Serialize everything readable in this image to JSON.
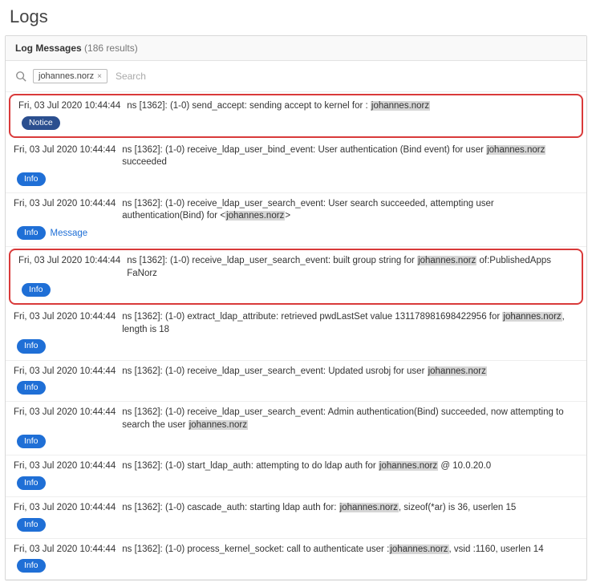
{
  "page": {
    "title": "Logs"
  },
  "panel": {
    "header_title": "Log Messages",
    "results_label": "(186 results)"
  },
  "filter": {
    "chip": "johannes.norz",
    "chip_close": "×",
    "placeholder": "Search"
  },
  "badges": {
    "info": "Info",
    "notice": "Notice"
  },
  "user_highlight": "johannes.norz",
  "entries": [
    {
      "ts": "Fri, 03 Jul 2020 10:44:44",
      "pre": "ns [1362]: (1-0) send_accept: sending accept to kernel for : ",
      "post": "",
      "level": "notice",
      "boxed": true
    },
    {
      "ts": "Fri, 03 Jul 2020 10:44:44",
      "pre": "ns [1362]: (1-0) receive_ldap_user_bind_event: User authentication (Bind event) for user ",
      "post": " succeeded",
      "level": "info"
    },
    {
      "ts": "Fri, 03 Jul 2020 10:44:44",
      "pre": "ns [1362]: (1-0) receive_ldap_user_search_event: User search succeeded, attempting user authentication(Bind) for <",
      "post": ">",
      "level": "info",
      "extra": "Message"
    },
    {
      "ts": "Fri, 03 Jul 2020 10:44:44",
      "pre": "ns [1362]: (1-0) receive_ldap_user_search_event: built group string for ",
      "post": " of:PublishedApps FaNorz",
      "level": "info",
      "boxed": true
    },
    {
      "ts": "Fri, 03 Jul 2020 10:44:44",
      "pre": "ns [1362]: (1-0) extract_ldap_attribute: retrieved pwdLastSet value 131178981698422956 for ",
      "post": ", length is 18",
      "level": "info"
    },
    {
      "ts": "Fri, 03 Jul 2020 10:44:44",
      "pre": "ns [1362]: (1-0) receive_ldap_user_search_event: Updated usrobj for user ",
      "post": "",
      "level": "info"
    },
    {
      "ts": "Fri, 03 Jul 2020 10:44:44",
      "pre": "ns [1362]: (1-0) receive_ldap_user_search_event: Admin authentication(Bind) succeeded, now attempting to search the user ",
      "post": "",
      "level": "info"
    },
    {
      "ts": "Fri, 03 Jul 2020 10:44:44",
      "pre": "ns [1362]: (1-0) start_ldap_auth: attempting to do ldap auth for ",
      "post": " @ 10.0.20.0",
      "level": "info"
    },
    {
      "ts": "Fri, 03 Jul 2020 10:44:44",
      "pre": "ns [1362]: (1-0) cascade_auth: starting ldap auth for: ",
      "post": ", sizeof(*ar) is 36, userlen 15",
      "level": "info"
    },
    {
      "ts": "Fri, 03 Jul 2020 10:44:44",
      "pre": "ns [1362]: (1-0) process_kernel_socket: call to authenticate user :",
      "post": ", vsid :1160, userlen 14",
      "level": "info"
    }
  ]
}
